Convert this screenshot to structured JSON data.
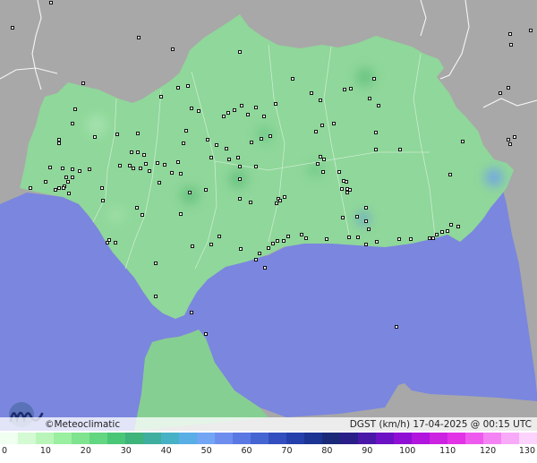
{
  "credit": "©Meteoclimatic",
  "caption": "DGST (km/h)  17-04-2025 @ 00:15 UTC",
  "colors": {
    "sea": "#7b86de",
    "land_outside": "#a9a9a9",
    "andalusia_base": "#8fd79a",
    "borders": "#e8e8e8",
    "station_marker": "#000000"
  },
  "legend": {
    "ticks": [
      "0",
      "10",
      "20",
      "30",
      "40",
      "50",
      "60",
      "70",
      "80",
      "90",
      "100",
      "110",
      "120",
      "130"
    ],
    "colors": [
      "#f0fff0",
      "#d3fad3",
      "#b9f5b9",
      "#9aefa0",
      "#7fe38f",
      "#62d680",
      "#49c777",
      "#3eb37a",
      "#3fae9e",
      "#47b1c6",
      "#5aaee6",
      "#72a6f4",
      "#6e8eef",
      "#5a78e3",
      "#4565d2",
      "#334ebe",
      "#2540aa",
      "#1c3493",
      "#1b2a78",
      "#2a1e88",
      "#4a18a8",
      "#6c12c4",
      "#8f10d4",
      "#b215de",
      "#cc22e2",
      "#e233e6",
      "#ee5aee",
      "#f483f3",
      "#f8aaf8",
      "#fcd3fc"
    ]
  },
  "stations": [
    [
      14,
      31
    ],
    [
      57,
      3
    ],
    [
      155,
      42
    ],
    [
      193,
      55
    ],
    [
      268,
      58
    ],
    [
      327,
      88
    ],
    [
      392,
      99
    ],
    [
      418,
      88
    ],
    [
      413,
      110
    ],
    [
      385,
      100
    ],
    [
      358,
      112
    ],
    [
      348,
      104
    ],
    [
      423,
      118
    ],
    [
      360,
      140
    ],
    [
      373,
      138
    ],
    [
      353,
      147
    ],
    [
      420,
      148
    ],
    [
      308,
      116
    ],
    [
      295,
      130
    ],
    [
      286,
      120
    ],
    [
      270,
      118
    ],
    [
      277,
      128
    ],
    [
      262,
      123
    ],
    [
      255,
      126
    ],
    [
      210,
      96
    ],
    [
      199,
      98
    ],
    [
      214,
      121
    ],
    [
      250,
      130
    ],
    [
      222,
      124
    ],
    [
      208,
      146
    ],
    [
      205,
      160
    ],
    [
      180,
      108
    ],
    [
      232,
      156
    ],
    [
      302,
      152
    ],
    [
      292,
      155
    ],
    [
      281,
      159
    ],
    [
      242,
      162
    ],
    [
      253,
      166
    ],
    [
      256,
      178
    ],
    [
      266,
      176
    ],
    [
      268,
      186
    ],
    [
      286,
      186
    ],
    [
      268,
      200
    ],
    [
      236,
      176
    ],
    [
      212,
      215
    ],
    [
      230,
      212
    ],
    [
      268,
      222
    ],
    [
      280,
      226
    ],
    [
      309,
      227
    ],
    [
      318,
      220
    ],
    [
      311,
      222
    ],
    [
      313,
      224
    ],
    [
      355,
      183
    ],
    [
      358,
      175
    ],
    [
      362,
      178
    ],
    [
      361,
      192
    ],
    [
      379,
      192
    ],
    [
      384,
      202
    ],
    [
      388,
      211
    ],
    [
      388,
      215
    ],
    [
      387,
      203
    ],
    [
      382,
      211
    ],
    [
      391,
      212
    ],
    [
      409,
      232
    ],
    [
      383,
      243
    ],
    [
      399,
      242
    ],
    [
      409,
      247
    ],
    [
      412,
      256
    ],
    [
      447,
      167
    ],
    [
      420,
      167
    ],
    [
      503,
      195
    ],
    [
      517,
      158
    ],
    [
      568,
      156
    ],
    [
      570,
      161
    ],
    [
      575,
      153
    ],
    [
      559,
      104
    ],
    [
      568,
      98
    ],
    [
      570,
      38
    ],
    [
      571,
      50
    ],
    [
      593,
      34
    ],
    [
      504,
      251
    ],
    [
      512,
      253
    ],
    [
      494,
      259
    ],
    [
      500,
      258
    ],
    [
      488,
      262
    ],
    [
      484,
      266
    ],
    [
      480,
      266
    ],
    [
      459,
      267
    ],
    [
      446,
      267
    ],
    [
      421,
      270
    ],
    [
      409,
      273
    ],
    [
      400,
      265
    ],
    [
      390,
      265
    ],
    [
      365,
      267
    ],
    [
      342,
      266
    ],
    [
      337,
      262
    ],
    [
      322,
      264
    ],
    [
      317,
      269
    ],
    [
      310,
      269
    ],
    [
      305,
      272
    ],
    [
      300,
      277
    ],
    [
      290,
      283
    ],
    [
      286,
      290
    ],
    [
      296,
      299
    ],
    [
      269,
      278
    ],
    [
      245,
      264
    ],
    [
      236,
      273
    ],
    [
      202,
      239
    ],
    [
      174,
      294
    ],
    [
      215,
      275
    ],
    [
      159,
      240
    ],
    [
      153,
      232
    ],
    [
      122,
      268
    ],
    [
      120,
      271
    ],
    [
      129,
      271
    ],
    [
      74,
      198
    ],
    [
      81,
      198
    ],
    [
      76,
      203
    ],
    [
      72,
      208
    ],
    [
      71,
      210
    ],
    [
      77,
      216
    ],
    [
      66,
      210
    ],
    [
      62,
      212
    ],
    [
      51,
      203
    ],
    [
      34,
      210
    ],
    [
      56,
      187
    ],
    [
      70,
      188
    ],
    [
      81,
      189
    ],
    [
      89,
      191
    ],
    [
      100,
      189
    ],
    [
      114,
      210
    ],
    [
      115,
      224
    ],
    [
      147,
      170
    ],
    [
      154,
      170
    ],
    [
      161,
      173
    ],
    [
      163,
      183
    ],
    [
      157,
      188
    ],
    [
      149,
      188
    ],
    [
      145,
      185
    ],
    [
      134,
      185
    ],
    [
      167,
      191
    ],
    [
      176,
      182
    ],
    [
      184,
      184
    ],
    [
      192,
      193
    ],
    [
      178,
      204
    ],
    [
      199,
      181
    ],
    [
      202,
      194
    ],
    [
      154,
      149
    ],
    [
      131,
      150
    ],
    [
      93,
      93
    ],
    [
      106,
      153
    ],
    [
      81,
      138
    ],
    [
      84,
      122
    ],
    [
      66,
      156
    ],
    [
      66,
      160
    ],
    [
      174,
      331
    ],
    [
      214,
      349
    ],
    [
      230,
      373
    ],
    [
      443,
      365
    ]
  ]
}
